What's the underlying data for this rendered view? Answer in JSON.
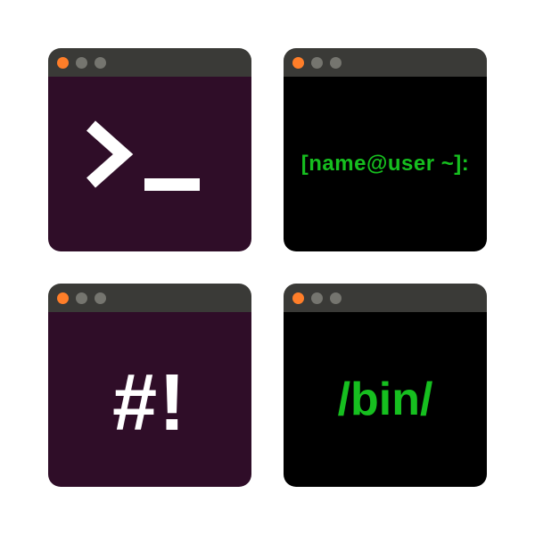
{
  "windows": {
    "top_left": {
      "bg": "purple",
      "content_type": "prompt_glyph"
    },
    "top_right": {
      "bg": "black",
      "text": "[name@user ~]:"
    },
    "bottom_left": {
      "bg": "purple",
      "text": "#!"
    },
    "bottom_right": {
      "bg": "black",
      "text": "/bin/"
    }
  },
  "colors": {
    "titlebar": "#3a3a37",
    "dot_active": "#ff7e29",
    "dot_inactive": "#75756f",
    "purple_bg": "#2f0d28",
    "black_bg": "#000000",
    "white_text": "#ffffff",
    "green_text": "#16bf1f"
  }
}
